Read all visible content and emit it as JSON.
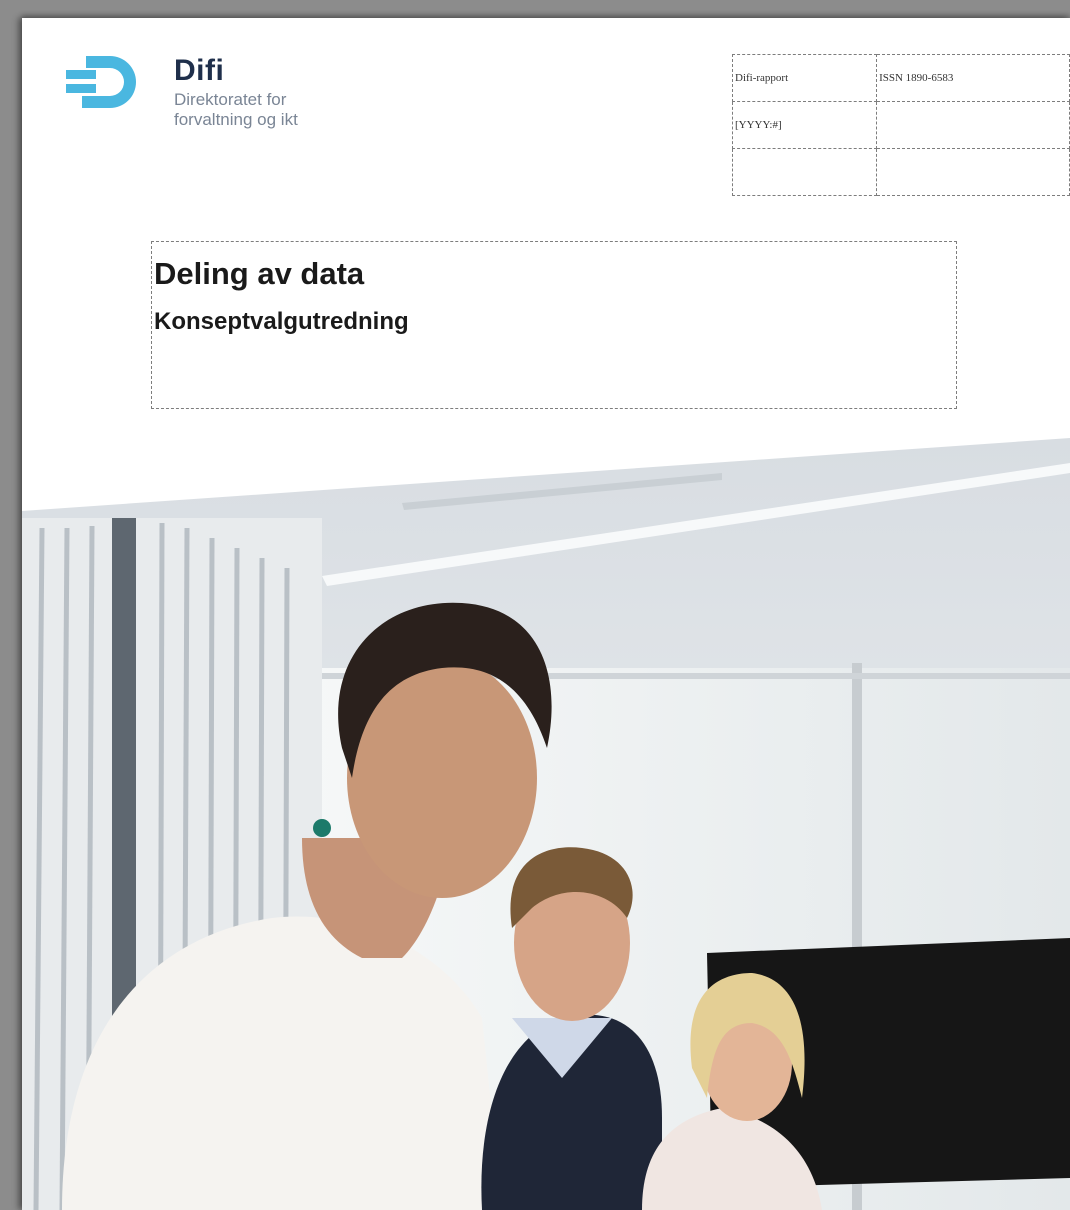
{
  "logo": {
    "title": "Difi",
    "subtitle_line1": "Direktoratet for",
    "subtitle_line2": "forvaltning og ikt",
    "brand_color": "#4ab7e0"
  },
  "meta_table": {
    "rows": [
      [
        "Difi-rapport",
        "ISSN 1890-6583"
      ],
      [
        "[YYYY:#]",
        ""
      ],
      [
        "",
        ""
      ]
    ]
  },
  "document": {
    "title": "Deling av data",
    "subtitle": "Konseptvalgutredning"
  },
  "cover_photo": {
    "icon": "office-meeting-photo"
  }
}
